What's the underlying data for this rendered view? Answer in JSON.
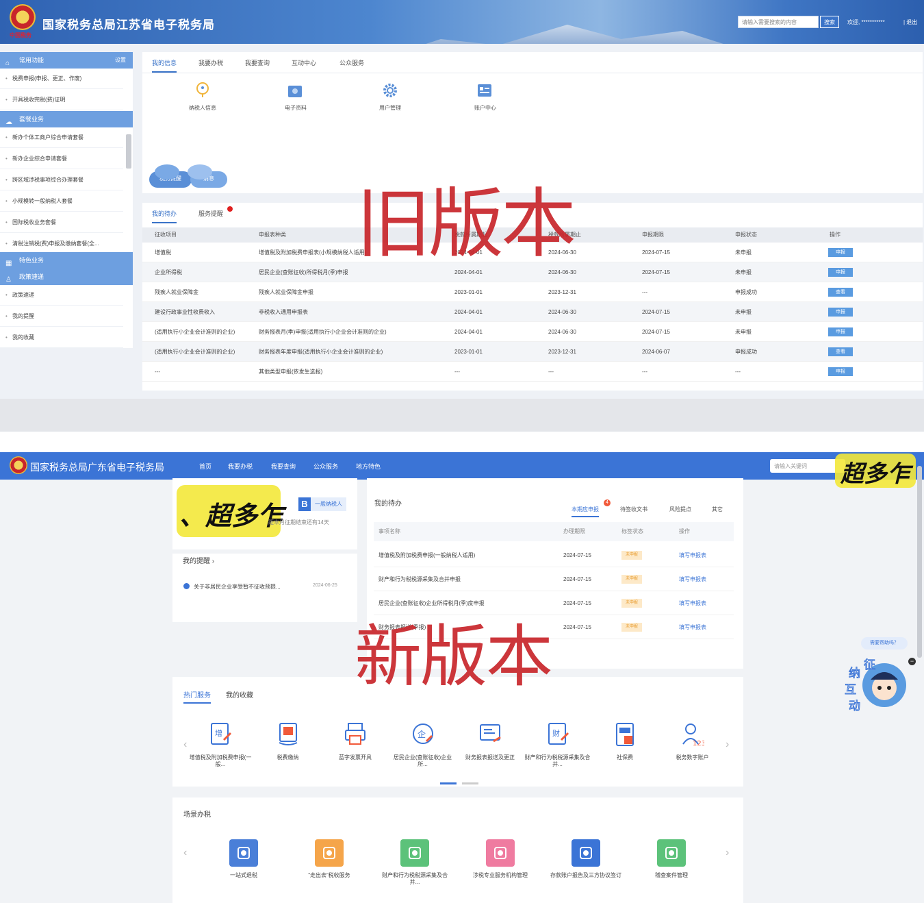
{
  "old": {
    "title": "国家税务总局江苏省电子税务局",
    "emblem_text": "中国税务",
    "search_placeholder": "请输入需要搜索的内容",
    "search_button": "搜索",
    "welcome": "欢迎, ***********",
    "logout": "| 退出",
    "sidebar": {
      "common_section": "常用功能",
      "common_action": "设置",
      "common_items": [
        "税费申报(申报、更正、作废)",
        "开具税收完税(费)证明"
      ],
      "package_section": "套餐业务",
      "package_items": [
        "新办个体工商户综合申请套餐",
        "新办企业综合申请套餐",
        "跨区域涉税事项综合办理套餐",
        "小规模转一般纳税人套餐",
        "国际税收业务套餐",
        "清税注销税(费)申报及缴纳套餐(全..."
      ],
      "feature_section": "特色业务",
      "policy_section": "政策速递",
      "policy_items": [
        "政策速递",
        "我的提醒",
        "我的收藏"
      ]
    },
    "tabs": [
      "我的信息",
      "我要办税",
      "我要查询",
      "互动中心",
      "公众服务"
    ],
    "info_icons": [
      {
        "icon": "user-info-icon",
        "label": "纳税人信息"
      },
      {
        "icon": "e-document-icon",
        "label": "电子资料"
      },
      {
        "icon": "gear-icon",
        "label": "用户管理"
      },
      {
        "icon": "account-center-icon",
        "label": "账户中心"
      }
    ],
    "cloud_buttons": [
      "税务提醒",
      "消息"
    ],
    "table_tabs": [
      "我的待办",
      "服务提醒"
    ],
    "table_headers": [
      "征收项目",
      "申报表种类",
      "税款所属期起",
      "税款所属期止",
      "申报期限",
      "申报状态",
      "操作"
    ],
    "rows": [
      [
        "增值税",
        "增值税及附加税费申报表(小规模纳税人适用)",
        "2024-04-01",
        "2024-06-30",
        "2024-07-15",
        "未申报",
        "申报"
      ],
      [
        "企业所得税",
        "居民企业(查账征收)所得税月(季)申报",
        "2024-04-01",
        "2024-06-30",
        "2024-07-15",
        "未申报",
        "申报"
      ],
      [
        "残疾人就业保障金",
        "残疾人就业保障金申报",
        "2023-01-01",
        "2023-12-31",
        "---",
        "申报成功",
        "查看"
      ],
      [
        "建设行政事业性收费收入",
        "非税收入通用申报表",
        "2024-04-01",
        "2024-06-30",
        "2024-07-15",
        "未申报",
        "申报"
      ],
      [
        "(适用执行小企业会计准则的企业)",
        "财务报表月(季)申报(适用执行小企业会计准则的企业)",
        "2024-04-01",
        "2024-06-30",
        "2024-07-15",
        "未申报",
        "申报"
      ],
      [
        "(适用执行小企业会计准则的企业)",
        "财务报表年度申报(适用执行小企业会计准则的企业)",
        "2023-01-01",
        "2023-12-31",
        "2024-06-07",
        "申报成功",
        "查看"
      ],
      [
        "---",
        "其他类型申报(依发生选报)",
        "---",
        "---",
        "---",
        "---",
        "申报"
      ]
    ],
    "stamp": "旧版本"
  },
  "new": {
    "title": "国家税务总局广东省电子税务局",
    "nav": [
      "首页",
      "我要办税",
      "我要查询",
      "公众服务",
      "地方特色"
    ],
    "search_placeholder": "请输入关键词",
    "handwriting_right": "超多乍",
    "handwriting_left": "、超多乍",
    "taxpayer_letter": "B",
    "taxpayer_type": "一般纳税人",
    "deadline": "距本月征期结束还有14天",
    "reminders_title": "我的提醒 ›",
    "reminder_item": "关于非居民企业享受暂不征收预提...",
    "reminder_date": "2024-06-25",
    "todo_title": "我的待办",
    "todo_tabs": [
      "本期应申报",
      "待签收文书",
      "风险提点",
      "其它"
    ],
    "todo_badge": "4",
    "todo_headers": [
      "事项名称",
      "办理期限",
      "标签状态",
      "操作"
    ],
    "todo_rows": [
      {
        "name": "增值税及附加税费申报(一般纳税人适用)",
        "deadline": "2024-07-15",
        "status": "未申报",
        "action": "填写申报表"
      },
      {
        "name": "财产和行为税税源采集及合并申报",
        "deadline": "2024-07-15",
        "status": "未申报",
        "action": "填写申报表"
      },
      {
        "name": "居民企业(查账征收)企业所得税月(季)度申报",
        "deadline": "2024-07-15",
        "status": "未申报",
        "action": "填写申报表"
      },
      {
        "name": "财务报表报送(季报)",
        "deadline": "2024-07-15",
        "status": "未申报",
        "action": "填写申报表"
      }
    ],
    "service_tabs": [
      "热门服务",
      "我的收藏"
    ],
    "services": [
      {
        "icon": "vat-declare-icon",
        "label": "增值税及附加税费申报(一般..."
      },
      {
        "icon": "tax-payment-icon",
        "label": "税费缴纳"
      },
      {
        "icon": "invoice-print-icon",
        "label": "蓝字发票开具"
      },
      {
        "icon": "enterprise-tax-icon",
        "label": "居民企业(查账征收)企业所..."
      },
      {
        "icon": "financial-report-icon",
        "label": "财务报表报送及更正"
      },
      {
        "icon": "property-tax-icon",
        "label": "财产和行为税税源采集及合并..."
      },
      {
        "icon": "social-security-icon",
        "label": "社保费"
      },
      {
        "icon": "digital-account-icon",
        "label": "税务数字账户"
      }
    ],
    "scene_title": "场景办税",
    "scenes": [
      {
        "icon": "one-stop-refund-icon",
        "label": "一站式退税",
        "color": "#4a7fd8"
      },
      {
        "icon": "go-global-icon",
        "label": "“走出去”税收服务",
        "color": "#f5a54a"
      },
      {
        "icon": "property-collect-icon",
        "label": "财产和行为税税源采集及合并...",
        "color": "#5cc27a"
      },
      {
        "icon": "agency-icon",
        "label": "涉税专业服务机构管理",
        "color": "#ef7ba0"
      },
      {
        "icon": "bank-agreement-icon",
        "label": "存款账户报告及三方协议签订",
        "color": "#3b74d6"
      },
      {
        "icon": "archive-icon",
        "label": "稽查案件管理",
        "color": "#5cc27a"
      }
    ],
    "help_text": "需要帮助吗？",
    "mascot_text": "征纳互动",
    "stamp": "新版本"
  }
}
